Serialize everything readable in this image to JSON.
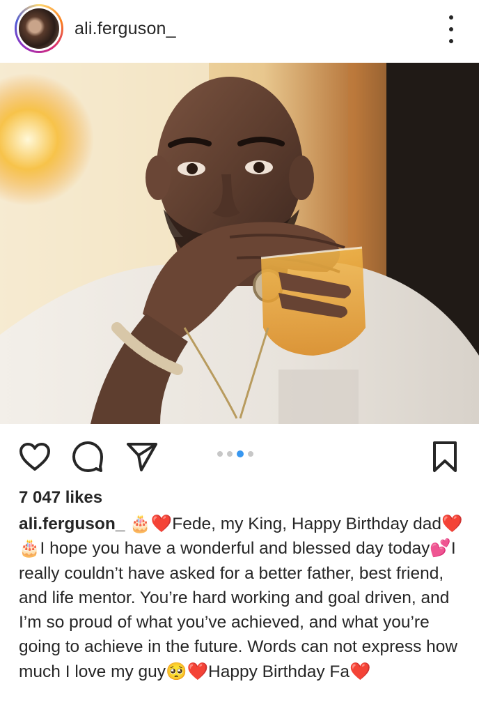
{
  "post": {
    "username": "ali.ferguson_",
    "likes_text": "7 047 likes",
    "caption": {
      "author": "ali.ferguson_",
      "text": " 🎂❤️Fede, my King, Happy Birthday dad❤️🎂I hope you have a wonderful and blessed day today💕I really couldn’t have asked for a better father, best friend, and life mentor. You’re hard working and goal driven, and I’m so proud of what you’ve achieved, and what you’re going to achieve in the future. Words can not express how much I love my guy🥺❤️Happy Birthday Fa❤️"
    },
    "carousel": {
      "count": 4,
      "active_index": 2
    }
  },
  "icons": {
    "more": "more-vertical-icon",
    "like": "heart-icon",
    "comment": "comment-icon",
    "share": "send-icon",
    "save": "bookmark-icon"
  },
  "colors": {
    "text": "#262626",
    "carousel_active": "#3897f0",
    "carousel_inactive": "#c7c7c7"
  }
}
